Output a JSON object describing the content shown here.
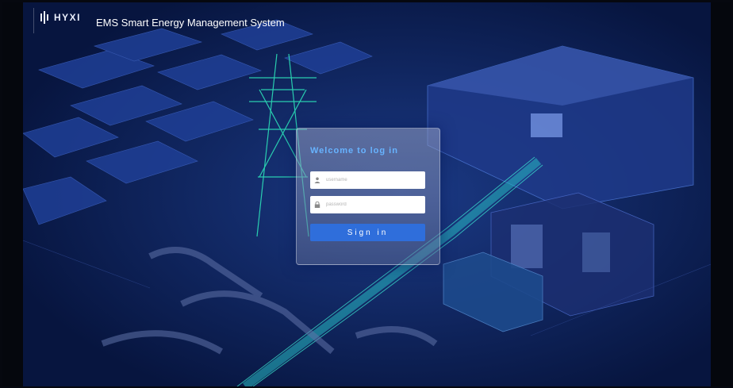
{
  "header": {
    "logo_text": "HYXI",
    "app_title": "EMS Smart Energy Management System"
  },
  "login": {
    "title": "Welcome to log in",
    "username_placeholder": "username",
    "password_placeholder": "password",
    "signin_label": "Sign in"
  },
  "icons": {
    "logo": "hyxi-logo-icon",
    "username": "user-icon",
    "password": "lock-icon"
  },
  "colors": {
    "title_accent": "#67b3ff",
    "button": "#2f6edb",
    "background": "#07153f"
  }
}
